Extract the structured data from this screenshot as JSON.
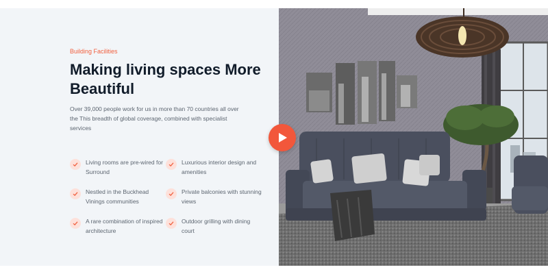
{
  "section": {
    "eyebrow": "Building Facilities",
    "title": "Making living spaces More Beautiful",
    "description": "Over 39,000 people work for us in more than 70 countries all over the This breadth of global coverage, combined with specialist services",
    "features": [
      "Living rooms are pre-wired for Surround",
      "Luxurious interior design and amenities",
      "Nestled in the Buckhead Vinings communities",
      "Private balconies with stunning views",
      "A rare combination of inspired architecture",
      "Outdoor grilling with dining court"
    ]
  },
  "media": {
    "image": "living-room-photo",
    "play_icon": "play-icon"
  },
  "colors": {
    "accent": "#f2573b",
    "eyebrow": "#f1603f",
    "heading": "#111c2a",
    "panel_bg": "#f2f5f8",
    "check_bg": "#fde1db"
  }
}
